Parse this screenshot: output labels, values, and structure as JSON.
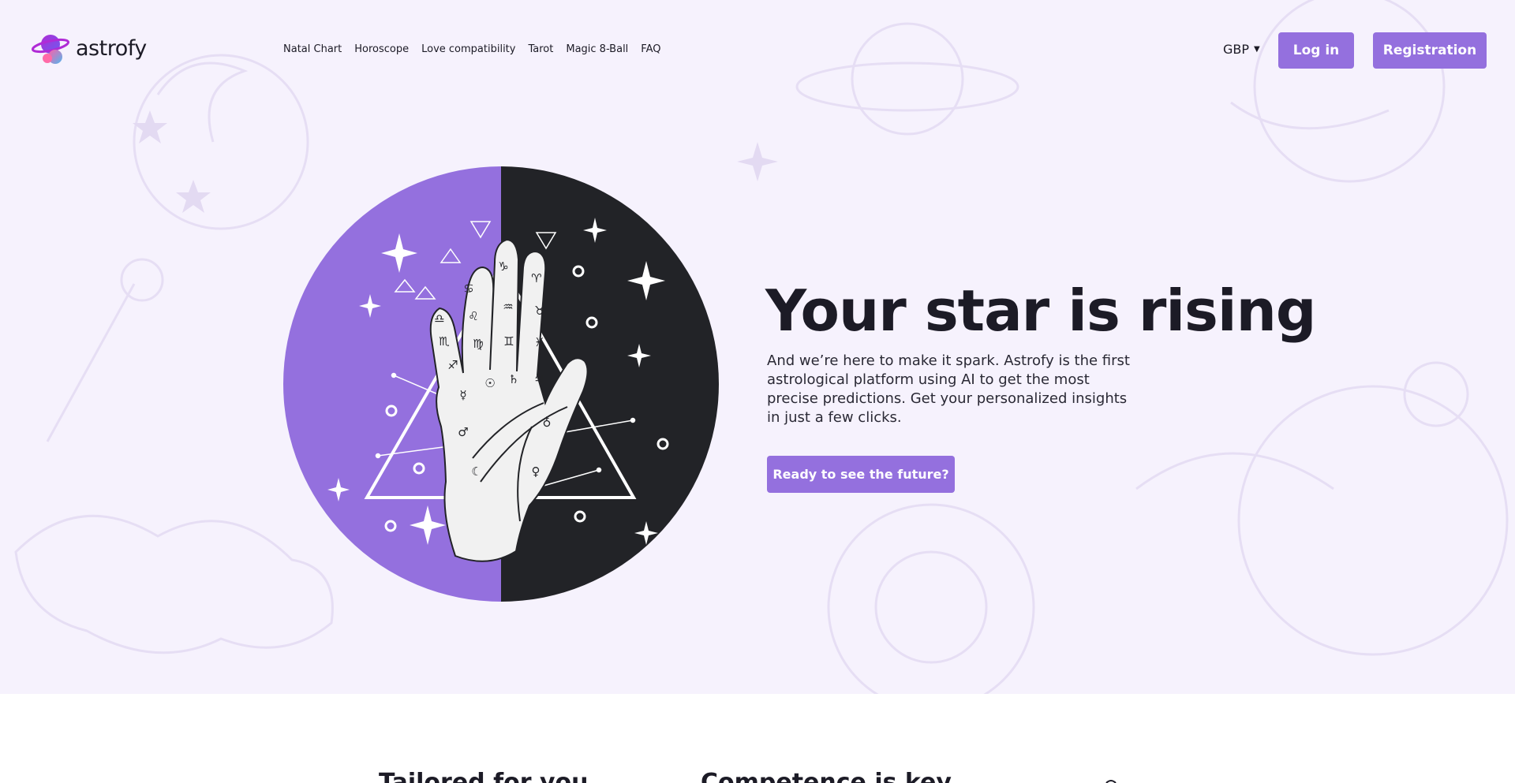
{
  "brand": {
    "name": "astrofy"
  },
  "nav": {
    "items": [
      {
        "label": "Natal Chart"
      },
      {
        "label": "Horoscope"
      },
      {
        "label": "Love compatibility"
      },
      {
        "label": "Tarot"
      },
      {
        "label": "Magic 8-Ball"
      },
      {
        "label": "FAQ"
      }
    ]
  },
  "currency": {
    "selected": "GBP",
    "icon": "caret-down-icon"
  },
  "auth": {
    "login_label": "Log in",
    "register_label": "Registration"
  },
  "hero": {
    "title": "Your star is rising",
    "description": "And we’re here to make it spark. Astrofy is the first astrological platform using AI to get the most precise predictions. Get your personalized insights in just a few clicks.",
    "cta_label": "Ready to see the future?",
    "illustration": {
      "subject": "palmistry-hand",
      "zodiac_glyphs": [
        "♋",
        "♑",
        "♈",
        "♌",
        "♒",
        "♉",
        "♎",
        "♍",
        "♊",
        "♏",
        "♓",
        "♐",
        "☉",
        "♄",
        "♃",
        "☿",
        "♂",
        "♁",
        "☾",
        "♀"
      ]
    }
  },
  "features": {
    "headings": [
      {
        "title": "Tailored for you"
      },
      {
        "title": "Competence is key"
      }
    ]
  },
  "colors": {
    "accent": "#9470de",
    "hero_background": "#f6f2fd",
    "text": "#1c1b26",
    "dark": "#222327",
    "palm": "#f1f1f1"
  }
}
